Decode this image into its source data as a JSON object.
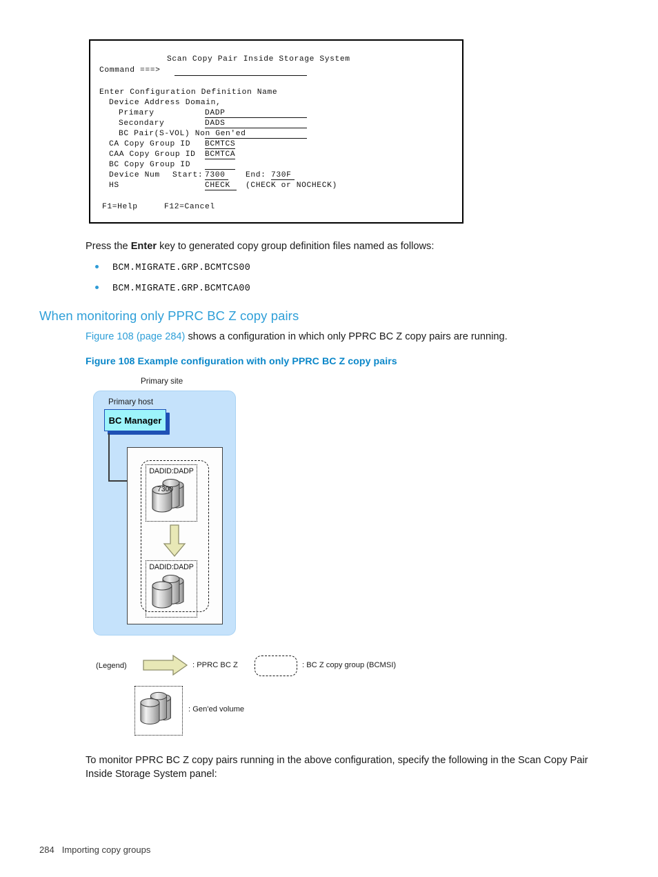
{
  "terminal": {
    "title": "Scan Copy Pair Inside Storage System",
    "command_label": "Command ===>",
    "command_value": "",
    "section_label": "Enter Configuration Definition Name",
    "domain_label": "Device Address Domain,",
    "rows": [
      {
        "label": "Primary",
        "value": "DADP"
      },
      {
        "label": "Secondary",
        "value": "DADS"
      },
      {
        "label": "BC Pair(S-VOL) Non Gen'ed",
        "value": ""
      },
      {
        "label": "CA Copy Group ID",
        "value": "BCMTCS"
      },
      {
        "label": "CAA Copy Group ID",
        "value": "BCMTCA"
      },
      {
        "label": "BC Copy Group ID",
        "value": ""
      }
    ],
    "device_num_label": "Device Num",
    "start_label": "Start:",
    "start_value": "7300",
    "end_label": "End:",
    "end_value": "730F",
    "hs_label": "HS",
    "hs_value": "CHECK",
    "hs_hint": "(CHECK or NOCHECK)",
    "keys": {
      "f1": "F1=Help",
      "f12": "F12=Cancel"
    }
  },
  "body": {
    "intro_before": "Press the ",
    "intro_bold": "Enter",
    "intro_after": " key to generated copy group definition files named as follows:",
    "bullets": [
      "BCM.MIGRATE.GRP.BCMTCS00",
      "BCM.MIGRATE.GRP.BCMTCA00"
    ],
    "heading": "When monitoring only PPRC BC Z copy pairs",
    "figure_ref_link": "Figure 108 (page 284)",
    "figure_ref_rest": " shows a configuration in which only PPRC BC Z copy pairs are running.",
    "figure_caption": "Figure 108 Example configuration with only PPRC BC Z copy pairs",
    "closing_paragraph": "To monitor PPRC BC Z copy pairs running in the above configuration, specify the following in the Scan Copy Pair Inside Storage System panel:"
  },
  "figure": {
    "primary_site_label": "Primary site",
    "primary_host_label": "Primary host",
    "bc_manager_label": "BC Manager",
    "volume_top_label": "DADID:DADP",
    "volume_top_number": "7300",
    "volume_bottom_label": "DADID:DADP",
    "legend": {
      "title": "(Legend)",
      "arrow_text": ": PPRC BC Z",
      "copygroup_text": ": BC Z copy group (BCMSI)",
      "volume_text": ": Gen'ed volume"
    },
    "colors": {
      "site_fill": "#c5e2fb",
      "bcm_fill": "#9df4fb",
      "bcm_border": "#1a4fb8",
      "arrow_fill": "#e8e8b6",
      "arrow_border": "#8f8f6a"
    }
  },
  "footer": {
    "page_number": "284",
    "section_title": "Importing copy groups"
  }
}
